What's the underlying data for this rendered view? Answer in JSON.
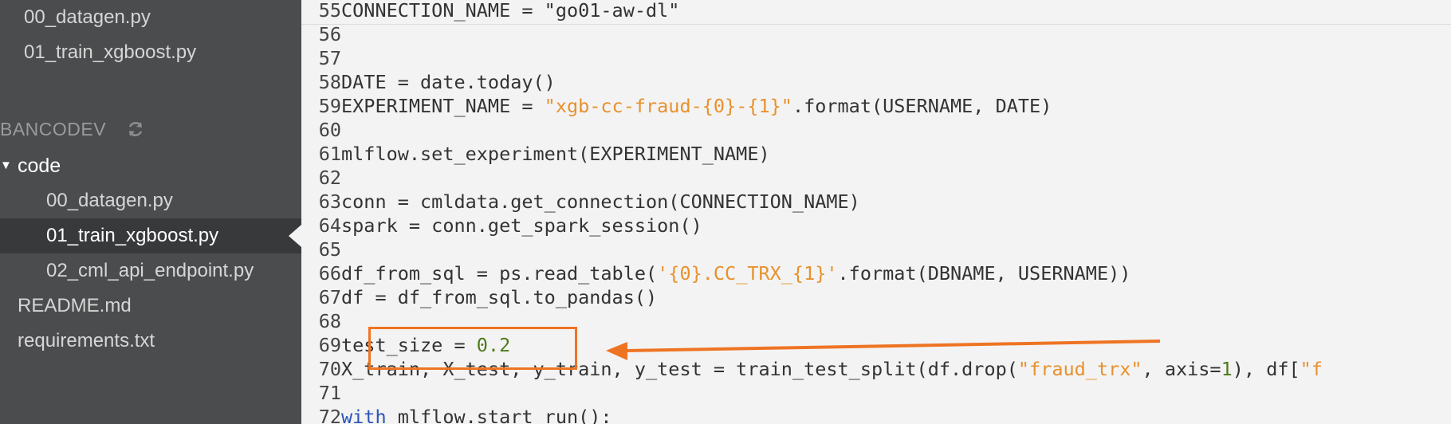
{
  "sidebar": {
    "files_top": [
      {
        "label": "00_datagen.py"
      },
      {
        "label": "01_train_xgboost.py"
      }
    ],
    "section_label": "BANCODEV",
    "folder": {
      "label": "code",
      "caret": "▼"
    },
    "folder_files": [
      {
        "label": "00_datagen.py"
      },
      {
        "label": "01_train_xgboost.py"
      },
      {
        "label": "02_cml_api_endpoint.py"
      }
    ],
    "root_files": [
      {
        "label": "README.md"
      },
      {
        "label": "requirements.txt"
      }
    ]
  },
  "editor": {
    "lines": [
      {
        "num": "55",
        "code": "CONNECTION_NAME = \"go01-aw-dl\""
      },
      {
        "num": "56",
        "code": ""
      },
      {
        "num": "57",
        "code": ""
      },
      {
        "num": "58",
        "code": "DATE = date.today()"
      },
      {
        "num": "59",
        "pre": "EXPERIMENT_NAME = ",
        "str": "\"xgb-cc-fraud-{0}-{1}\"",
        "post": ".format(USERNAME, DATE)"
      },
      {
        "num": "60",
        "code": ""
      },
      {
        "num": "61",
        "code": "mlflow.set_experiment(EXPERIMENT_NAME)"
      },
      {
        "num": "62",
        "code": ""
      },
      {
        "num": "63",
        "code": "conn = cmldata.get_connection(CONNECTION_NAME)"
      },
      {
        "num": "64",
        "code": "spark = conn.get_spark_session()"
      },
      {
        "num": "65",
        "code": ""
      },
      {
        "num": "66",
        "pre": "df_from_sql = ps.read_table(",
        "str": "'{0}.CC_TRX_{1}'",
        "post": ".format(DBNAME, USERNAME))"
      },
      {
        "num": "67",
        "code": "df = df_from_sql.to_pandas()"
      },
      {
        "num": "68",
        "code": ""
      },
      {
        "num": "69",
        "pre": "test_size = ",
        "num_val": "0.2"
      },
      {
        "num": "70",
        "pre": "X_train, X_test, y_train, y_test = train_test_split(df.drop(",
        "str": "\"fraud_trx\"",
        "mid": ", axis=",
        "num_val2": "1",
        "post2": "), df[",
        "str2": "\"f"
      },
      {
        "num": "71",
        "code": ""
      },
      {
        "num": "72",
        "kw": "with",
        "post": " mlflow.start_run():"
      }
    ]
  },
  "colors": {
    "annotation": "#ee7423",
    "sidebar_bg": "#4b4c4e",
    "editor_bg": "#f3f3f3",
    "string": "#e8912d"
  },
  "icons": {
    "refresh": "refresh-icon",
    "caret": "caret-down-icon"
  }
}
